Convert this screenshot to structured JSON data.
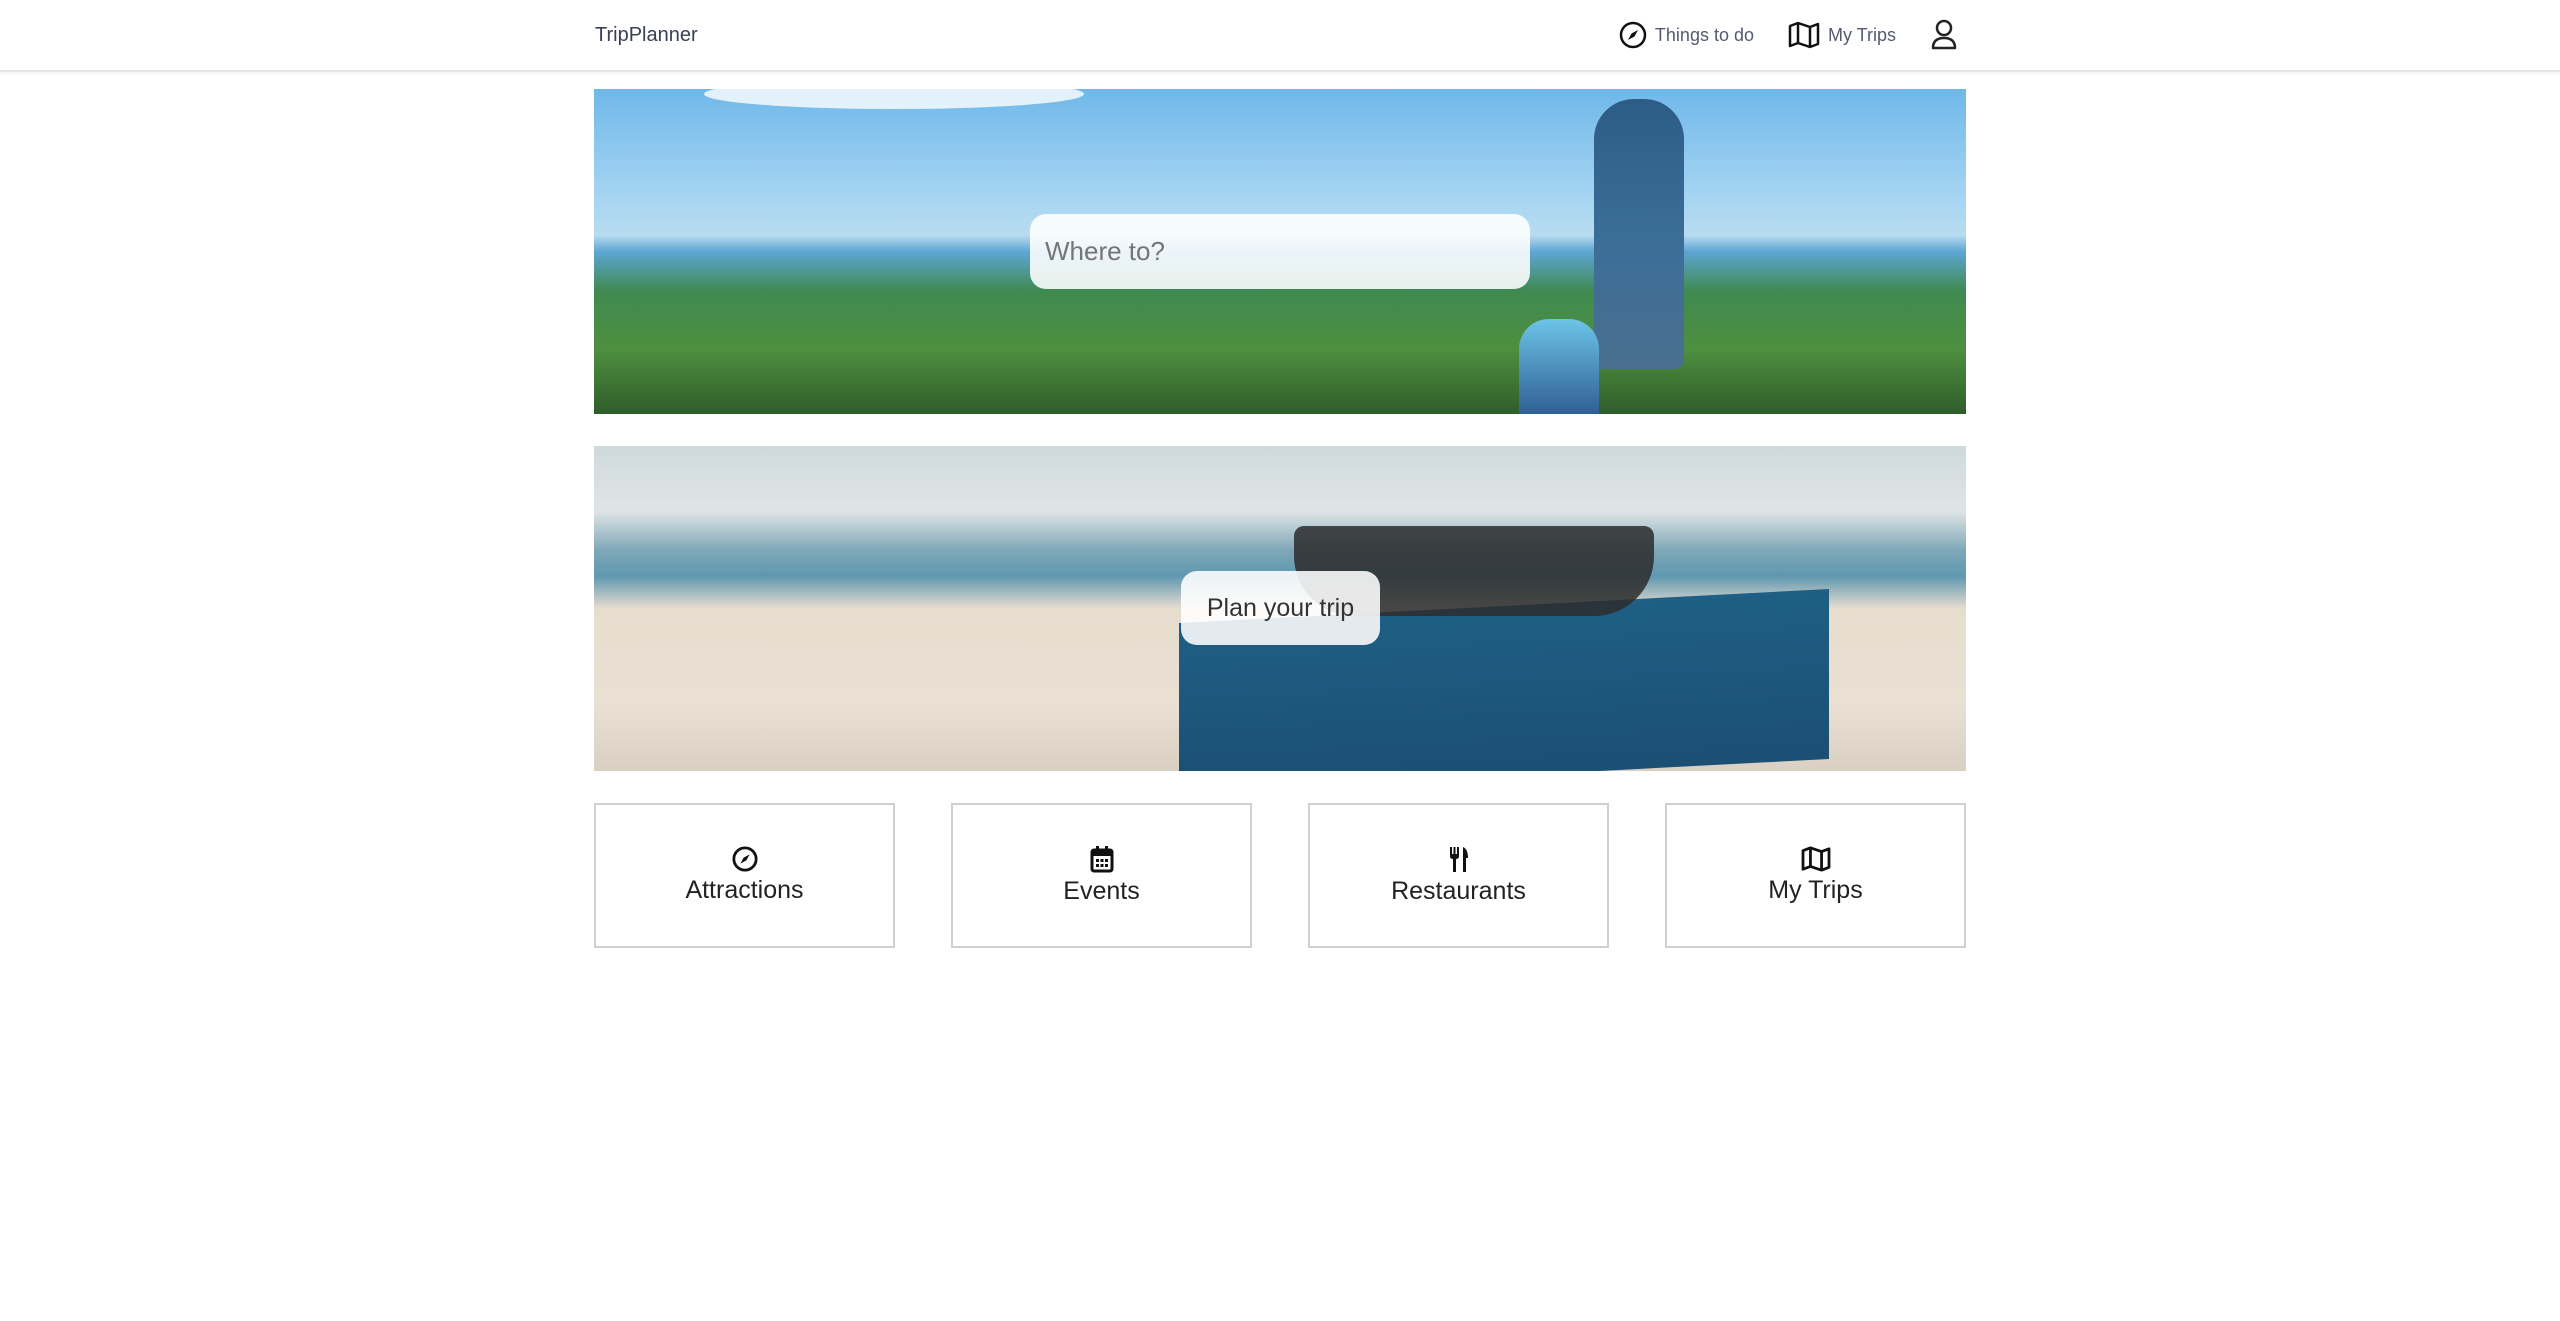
{
  "header": {
    "brand": "TripPlanner",
    "nav": [
      {
        "label": "Things to do",
        "icon": "compass-icon"
      },
      {
        "label": "My Trips",
        "icon": "map-icon"
      }
    ],
    "profile_icon": "user-icon"
  },
  "hero_search": {
    "placeholder": "Where to?"
  },
  "hero_plan": {
    "button_label": "Plan your trip"
  },
  "categories": [
    {
      "label": "Attractions",
      "icon": "compass-icon"
    },
    {
      "label": "Events",
      "icon": "calendar-icon"
    },
    {
      "label": "Restaurants",
      "icon": "utensils-icon"
    },
    {
      "label": "My Trips",
      "icon": "map-icon"
    }
  ]
}
